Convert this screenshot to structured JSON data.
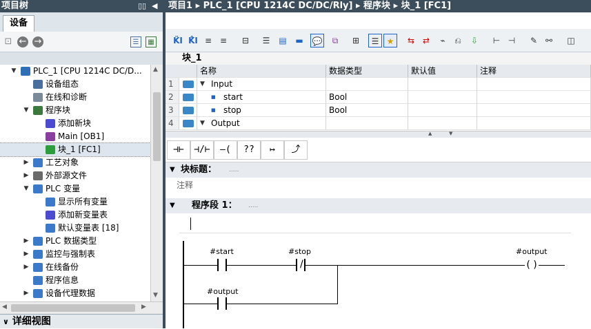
{
  "left_pane": {
    "header": "项目树",
    "tab_device": "设备",
    "detail_view": "详细视图",
    "tree": [
      {
        "label": "PLC_1 [CPU 1214C DC/D...",
        "indent": 0,
        "expand": "▼",
        "icon": "plc-icon",
        "color": "#2e6fb7"
      },
      {
        "label": "设备组态",
        "indent": 1,
        "expand": "",
        "icon": "device-config-icon",
        "color": "#4a6e9e"
      },
      {
        "label": "在线和诊断",
        "indent": 1,
        "expand": "",
        "icon": "online-diagnostics-icon",
        "color": "#7a8a99"
      },
      {
        "label": "程序块",
        "indent": 1,
        "expand": "▼",
        "icon": "program-blocks-icon",
        "color": "#3b7a3b"
      },
      {
        "label": "添加新块",
        "indent": 2,
        "expand": "",
        "icon": "add-new-block-icon",
        "color": "#4b4bd0"
      },
      {
        "label": "Main [OB1]",
        "indent": 2,
        "expand": "",
        "icon": "ob-block-icon",
        "color": "#8a3ea0"
      },
      {
        "label": "块_1 [FC1]",
        "indent": 2,
        "expand": "",
        "icon": "fc-block-icon",
        "color": "#2d9e3e",
        "selected": true
      },
      {
        "label": "工艺对象",
        "indent": 1,
        "expand": "▶",
        "icon": "technology-objects-icon",
        "color": "#3a7ac8"
      },
      {
        "label": "外部源文件",
        "indent": 1,
        "expand": "▶",
        "icon": "external-source-icon",
        "color": "#6a6a6a"
      },
      {
        "label": "PLC 变量",
        "indent": 1,
        "expand": "▼",
        "icon": "plc-tags-icon",
        "color": "#3a7ac8"
      },
      {
        "label": "显示所有变量",
        "indent": 2,
        "expand": "",
        "icon": "show-all-tags-icon",
        "color": "#3a7ac8"
      },
      {
        "label": "添加新变量表",
        "indent": 2,
        "expand": "",
        "icon": "add-tag-table-icon",
        "color": "#4b4bd0"
      },
      {
        "label": "默认变量表 [18]",
        "indent": 2,
        "expand": "",
        "icon": "default-tag-table-icon",
        "color": "#3a7ac8"
      },
      {
        "label": "PLC 数据类型",
        "indent": 1,
        "expand": "▶",
        "icon": "plc-data-types-icon",
        "color": "#3a7ac8"
      },
      {
        "label": "监控与强制表",
        "indent": 1,
        "expand": "▶",
        "icon": "watch-force-tables-icon",
        "color": "#3a7ac8"
      },
      {
        "label": "在线备份",
        "indent": 1,
        "expand": "▶",
        "icon": "online-backup-icon",
        "color": "#3a7ac8"
      },
      {
        "label": "程序信息",
        "indent": 1,
        "expand": "",
        "icon": "program-info-icon",
        "color": "#3a7ac8"
      },
      {
        "label": "设备代理数据",
        "indent": 1,
        "expand": "▶",
        "icon": "device-proxy-data-icon",
        "color": "#3a7ac8"
      }
    ]
  },
  "breadcrumb": {
    "project": "项目1",
    "plc": "PLC_1 [CPU 1214C DC/DC/Rly]",
    "blocks": "程序块",
    "block": "块_1 [FC1]"
  },
  "block_name": "块_1",
  "interface": {
    "headers": [
      "名称",
      "数据类型",
      "默认值",
      "注释"
    ],
    "rows": [
      {
        "num": "1",
        "name": "Input",
        "type": "",
        "default": "",
        "comment": "",
        "expand": "▼"
      },
      {
        "num": "2",
        "name": "start",
        "type": "Bool",
        "default": "",
        "comment": "",
        "expand": "■"
      },
      {
        "num": "3",
        "name": "stop",
        "type": "Bool",
        "default": "",
        "comment": "",
        "expand": "■"
      },
      {
        "num": "4",
        "name": "Output",
        "type": "",
        "default": "",
        "comment": "",
        "expand": "▼"
      }
    ]
  },
  "ladder_toolbar": [
    "⊣⊢",
    "⊣/⊢",
    "–( )–",
    "??",
    "↦",
    "⤴"
  ],
  "block_title": {
    "label": "块标题：",
    "dots": "....."
  },
  "comment_placeholder": "注释",
  "network": {
    "label": "程序段 1：",
    "dots": "....."
  },
  "ladder": {
    "contact1": "#start",
    "contact2": "#stop",
    "coil": "#output",
    "contact3": "#output"
  }
}
